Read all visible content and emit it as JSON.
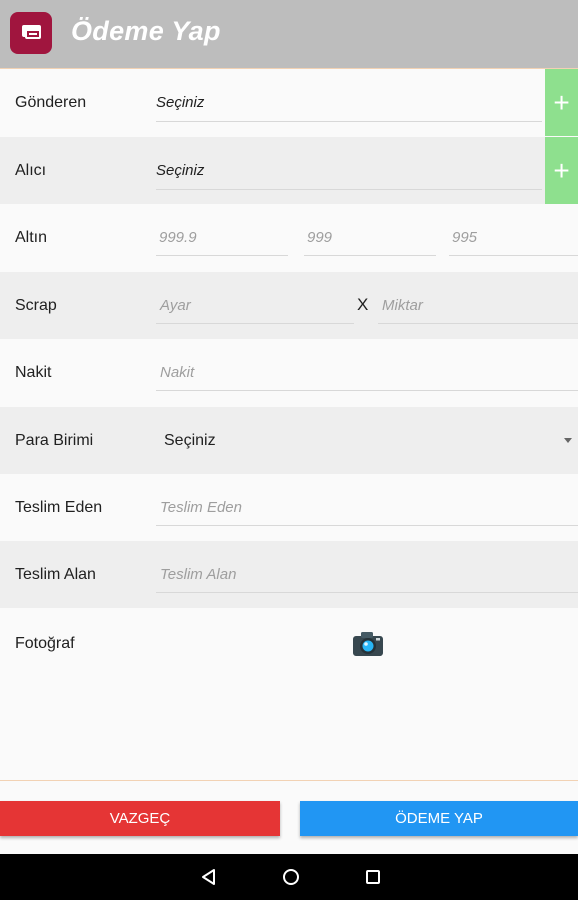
{
  "header": {
    "title": "Ödeme Yap",
    "app_icon": "wallet-card-icon"
  },
  "form": {
    "sender": {
      "label": "Gönderen",
      "value": "Seçiniz",
      "add_icon": "+"
    },
    "receiver": {
      "label": "Alıcı",
      "value": "Seçiniz",
      "add_icon": "+"
    },
    "gold": {
      "label": "Altın",
      "fields": [
        "999.9",
        "999",
        "995"
      ]
    },
    "scrap": {
      "label": "Scrap",
      "purity_placeholder": "Ayar",
      "times": "X",
      "amount_placeholder": "Miktar"
    },
    "cash": {
      "label": "Nakit",
      "placeholder": "Nakit"
    },
    "currency": {
      "label": "Para Birimi",
      "value": "Seçiniz"
    },
    "delivered_by": {
      "label": "Teslim Eden",
      "placeholder": "Teslim Eden"
    },
    "received_by": {
      "label": "Teslim Alan",
      "placeholder": "Teslim Alan"
    },
    "photo": {
      "label": "Fotoğraf",
      "icon": "camera-icon"
    }
  },
  "actions": {
    "cancel": "VAZGEÇ",
    "pay": "ÖDEME YAP"
  },
  "colors": {
    "topbar": "#bdbdbd",
    "brand": "#a0153e",
    "add": "#8ee08e",
    "cancel": "#e53535",
    "pay": "#2196f3"
  }
}
